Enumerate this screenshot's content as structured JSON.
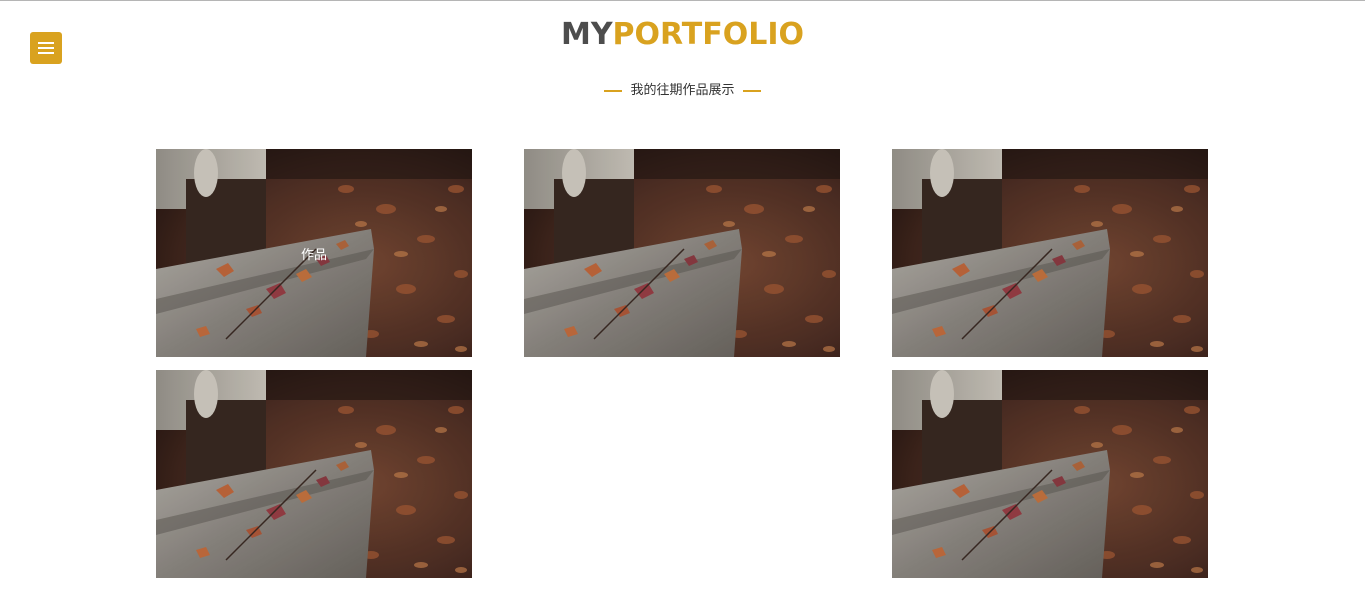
{
  "header": {
    "logo_part1": "MY",
    "logo_part2": "PORTFOLIO",
    "subtitle": "我的往期作品展示",
    "menu_icon": "hamburger-menu-icon"
  },
  "colors": {
    "accent": "#d9a21f",
    "logo_dark": "#4d4d4d"
  },
  "portfolio": {
    "items": [
      {
        "image": "autumn-leaves-bench-photo",
        "caption": "作品"
      },
      {
        "image": "autumn-leaves-bench-photo",
        "caption": ""
      },
      {
        "image": "autumn-leaves-bench-photo",
        "caption": ""
      },
      {
        "image": "autumn-leaves-bench-photo",
        "caption": ""
      },
      {
        "image": "autumn-leaves-bench-photo",
        "caption": ""
      }
    ]
  }
}
